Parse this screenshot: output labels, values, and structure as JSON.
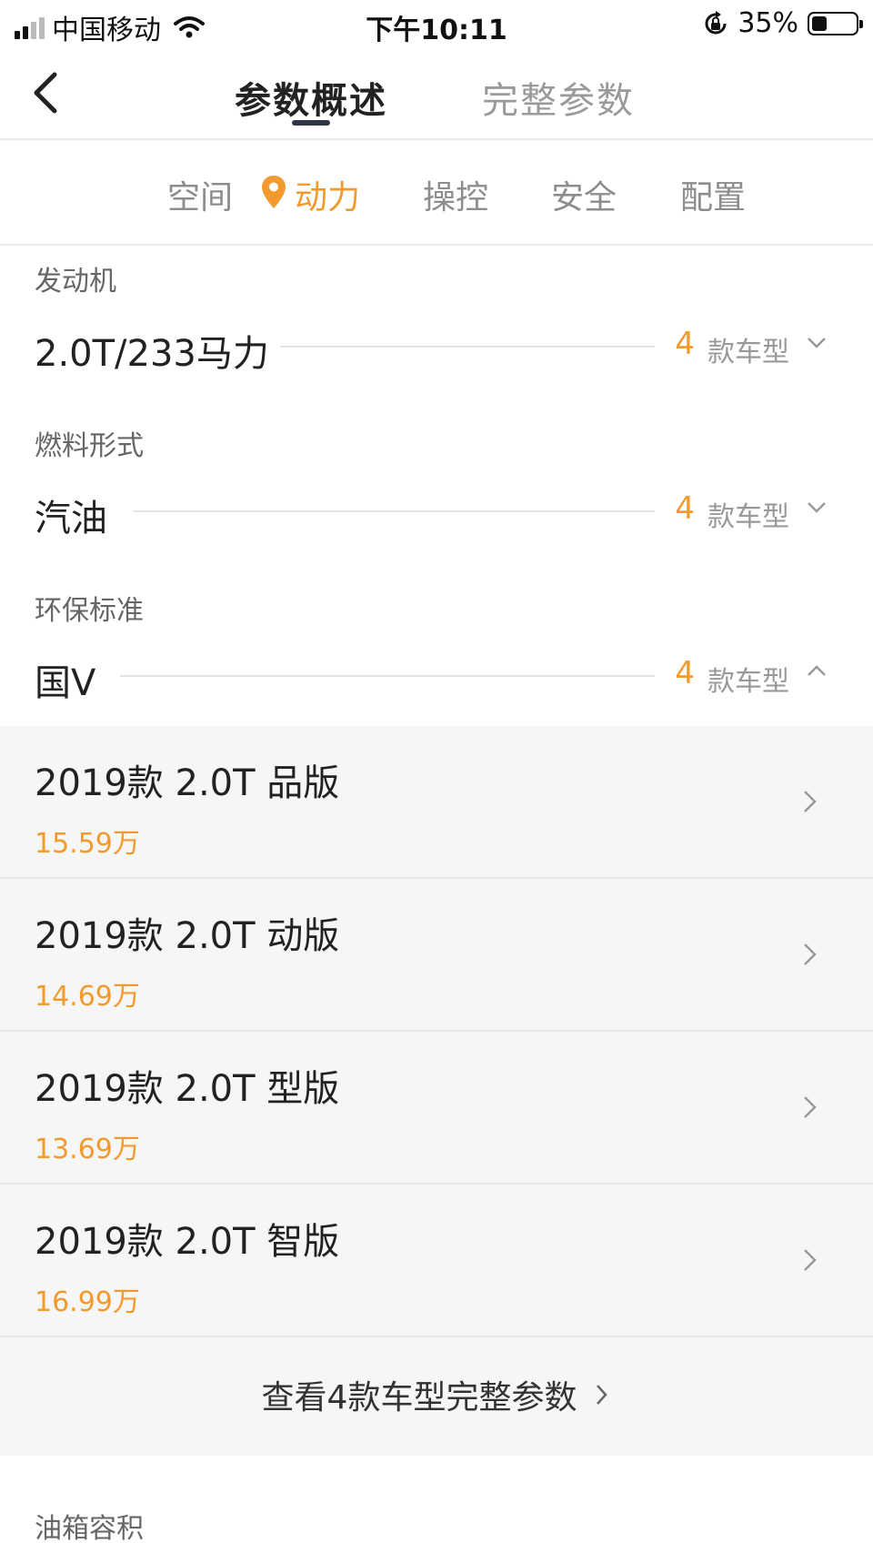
{
  "status_bar": {
    "carrier": "中国移动",
    "time": "下午10:11",
    "battery": "35%",
    "battery_level": 0.35
  },
  "nav": {
    "tab_overview": "参数概述",
    "tab_full": "完整参数"
  },
  "categories": [
    "空间",
    "动力",
    "操控",
    "安全",
    "配置"
  ],
  "active_category": "动力",
  "params": [
    {
      "label": "发动机",
      "value": "2.0T/233马力",
      "count": "4",
      "unit": "款车型",
      "expanded": false
    },
    {
      "label": "燃料形式",
      "value": "汽油",
      "count": "4",
      "unit": "款车型",
      "expanded": false
    },
    {
      "label": "环保标准",
      "value": "国V",
      "count": "4",
      "unit": "款车型",
      "expanded": true
    }
  ],
  "models": [
    {
      "name": "2019款 2.0T 品版",
      "price": "15.59万"
    },
    {
      "name": "2019款 2.0T 动版",
      "price": "14.69万"
    },
    {
      "name": "2019款 2.0T 型版",
      "price": "13.69万"
    },
    {
      "name": "2019款 2.0T 智版",
      "price": "16.99万"
    }
  ],
  "more_link": "查看4款车型完整参数",
  "next_param_label": "油箱容积",
  "colors": {
    "accent": "#f29a2e",
    "indicator": "#2f3446",
    "list_bg": "#f6f6f6"
  }
}
